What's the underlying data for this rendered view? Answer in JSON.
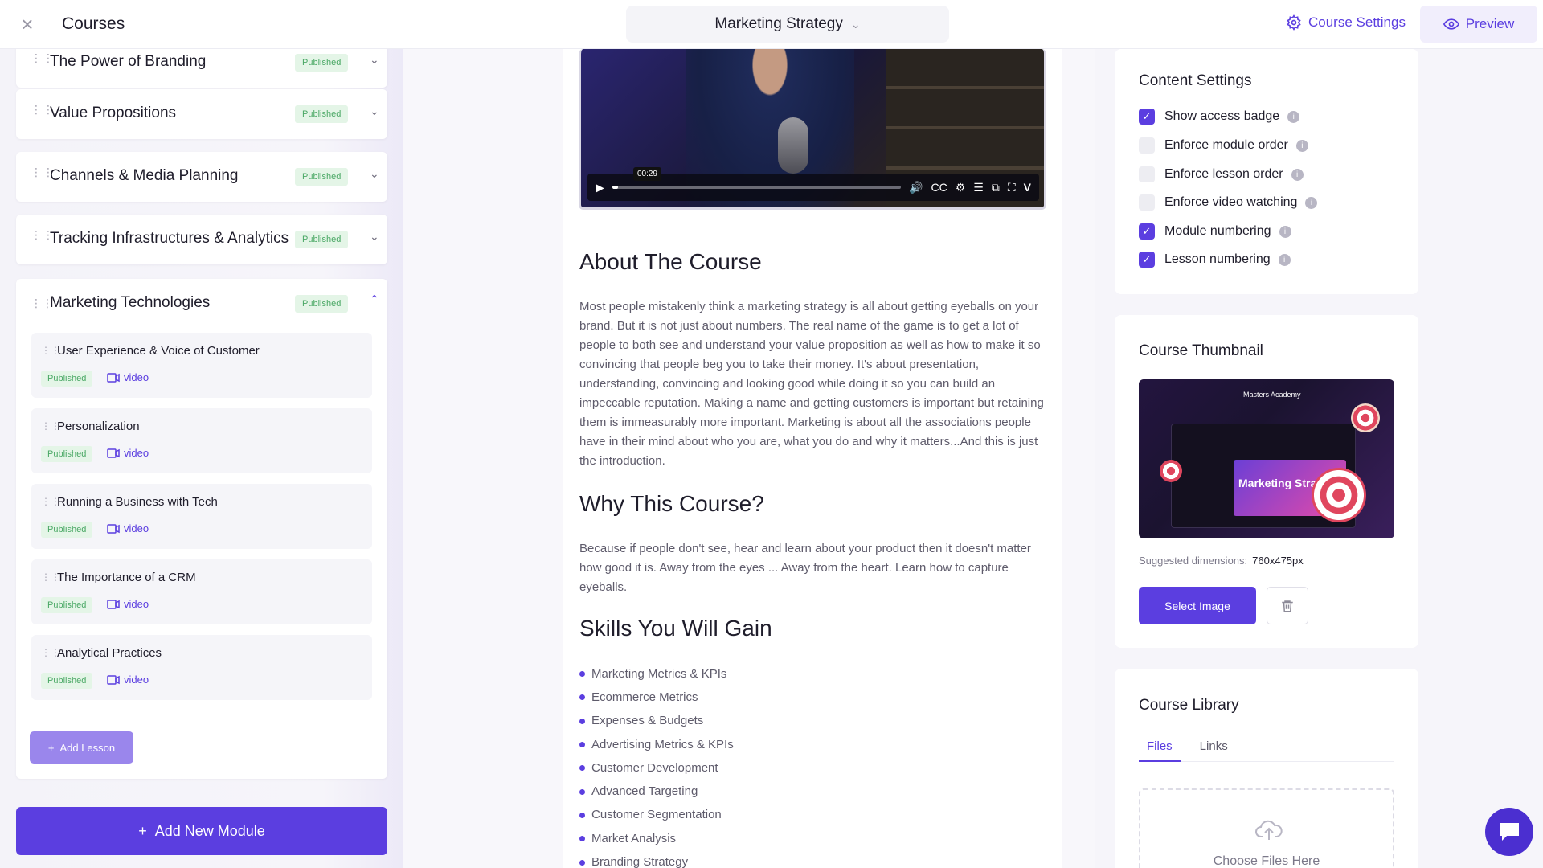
{
  "topbar": {
    "title": "Courses",
    "course_name": "Marketing Strategy",
    "settings_label": "Course Settings",
    "preview_label": "Preview"
  },
  "modules": [
    {
      "title": "The Power of Branding",
      "status": "Published"
    },
    {
      "title": "Value Propositions",
      "status": "Published"
    },
    {
      "title": "Channels & Media Planning",
      "status": "Published"
    },
    {
      "title": "Tracking Infrastructures & Analytics",
      "status": "Published"
    }
  ],
  "open_module": {
    "title": "Marketing Technologies",
    "status": "Published",
    "lessons": [
      {
        "title": "User Experience & Voice of Customer",
        "status": "Published",
        "type": "video"
      },
      {
        "title": "Personalization",
        "status": "Published",
        "type": "video"
      },
      {
        "title": "Running a Business with Tech",
        "status": "Published",
        "type": "video"
      },
      {
        "title": "The Importance of a CRM",
        "status": "Published",
        "type": "video"
      },
      {
        "title": "Analytical Practices",
        "status": "Published",
        "type": "video"
      }
    ],
    "add_lesson_label": "Add Lesson"
  },
  "add_module_label": "Add New Module",
  "video": {
    "time": "00:29",
    "progress": 0.02
  },
  "content": {
    "about_heading": "About The Course",
    "about_text": "Most people mistakenly think a marketing strategy is all about getting eyeballs on your brand. But it is not just about numbers. The real name of the game is to get a lot of people to both see and understand your value proposition as well as how to make it so convincing that people beg you to take their money. It's about presentation, understanding, convincing and looking good while doing it so you can build an impeccable reputation. Making a name and getting customers is important but retaining them is immeasurably more important. Marketing is about all the associations people have in their mind about who you are, what you do and why it matters...And this is just the introduction.",
    "why_heading": "Why This Course?",
    "why_text": "Because if people don't see, hear and learn about your product then it doesn't matter how good it is. Away from the eyes ... Away from the heart. Learn how to capture eyeballs.",
    "skills_heading": "Skills You Will Gain",
    "skills": [
      "Marketing Metrics & KPIs",
      "Ecommerce Metrics",
      "Expenses & Budgets",
      "Advertising Metrics & KPIs",
      "Customer Development",
      "Advanced Targeting",
      "Customer Segmentation",
      "Market Analysis",
      "Branding Strategy"
    ]
  },
  "content_settings": {
    "title": "Content Settings",
    "options": [
      {
        "label": "Show access badge",
        "checked": true
      },
      {
        "label": "Enforce module order",
        "checked": false
      },
      {
        "label": "Enforce lesson order",
        "checked": false
      },
      {
        "label": "Enforce video watching",
        "checked": false
      },
      {
        "label": "Module numbering",
        "checked": true
      },
      {
        "label": "Lesson numbering",
        "checked": true
      }
    ]
  },
  "thumbnail": {
    "title": "Course Thumbnail",
    "image_brand": "Masters Academy",
    "image_text": "Marketing Strategy",
    "dims_label": "Suggested dimensions:",
    "dims_value": "760x475px",
    "select_label": "Select Image"
  },
  "library": {
    "title": "Course Library",
    "tabs": [
      "Files",
      "Links"
    ],
    "active_tab": "Files",
    "drop_text": "Choose Files Here"
  },
  "colors": {
    "accent": "#5b3ee0",
    "published_bg": "#e4f5e7",
    "published_fg": "#4aa865"
  }
}
